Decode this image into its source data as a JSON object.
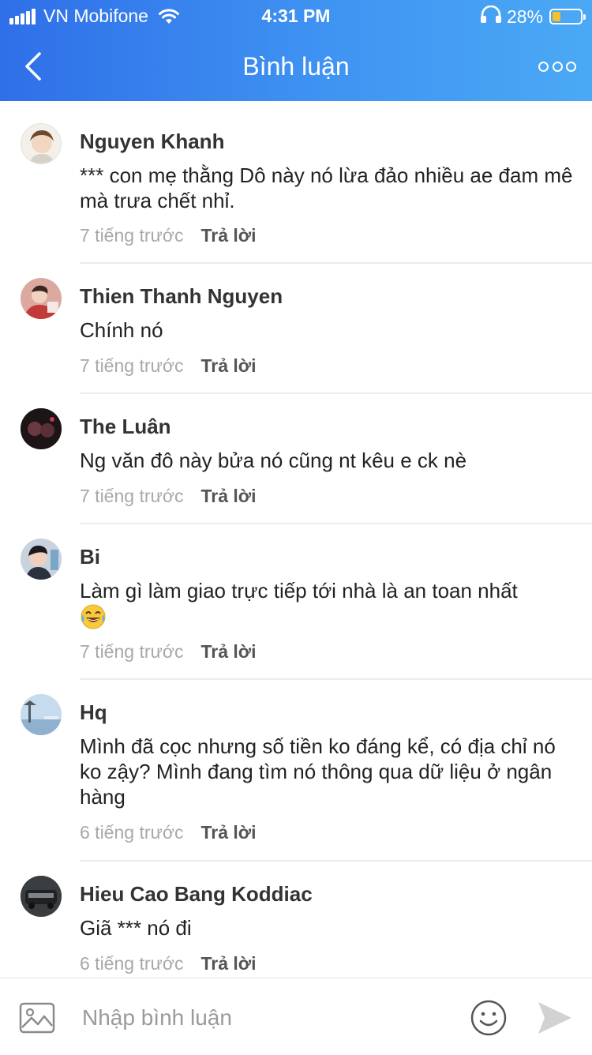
{
  "status_bar": {
    "carrier": "VN Mobifone",
    "time": "4:31 PM",
    "battery": "28%",
    "battery_color": "#f5c12a"
  },
  "nav": {
    "title": "Bình luận",
    "back_icon": "chevron-left-icon",
    "more_icon": "more-dots-icon"
  },
  "comments": [
    {
      "name": "Nguyen Khanh",
      "text": "*** con mẹ thằng Dô này nó lừa đảo nhiều ae đam mê mà trưa chết nhỉ.",
      "time": "7 tiếng trước",
      "reply": "Trả lời"
    },
    {
      "name": "Thien Thanh Nguyen",
      "text": "Chính nó",
      "time": "7 tiếng trước",
      "reply": "Trả lời"
    },
    {
      "name": "The Luân",
      "text": "Ng văn đô này bửa nó cũng nt kêu e ck nè",
      "time": "7 tiếng trước",
      "reply": "Trả lời"
    },
    {
      "name": "Bi",
      "text": "Làm gì làm giao trực tiếp tới nhà là an toan nhất",
      "emoji": "laughing-tears-emoji",
      "time": "7 tiếng trước",
      "reply": "Trả lời"
    },
    {
      "name": "Hq",
      "text": "Mình đã cọc nhưng số tiền ko đáng kể, có địa chỉ nó ko zậy? Mình đang tìm nó thông qua dữ liệu ở ngân hàng",
      "time": "6 tiếng trước",
      "reply": "Trả lời"
    },
    {
      "name": "Hieu Cao Bang Koddiac",
      "text": "Giã *** nó đi",
      "time": "6 tiếng trước",
      "reply": "Trả lời"
    }
  ],
  "input_bar": {
    "placeholder": "Nhập bình luận",
    "image_icon": "image-icon",
    "emoji_icon": "smile-icon",
    "send_icon": "send-icon"
  },
  "colors": {
    "header_start": "#2f6fe8",
    "header_end": "#4aa9f4",
    "time_text": "#a8a8a8",
    "divider": "#ececec"
  }
}
